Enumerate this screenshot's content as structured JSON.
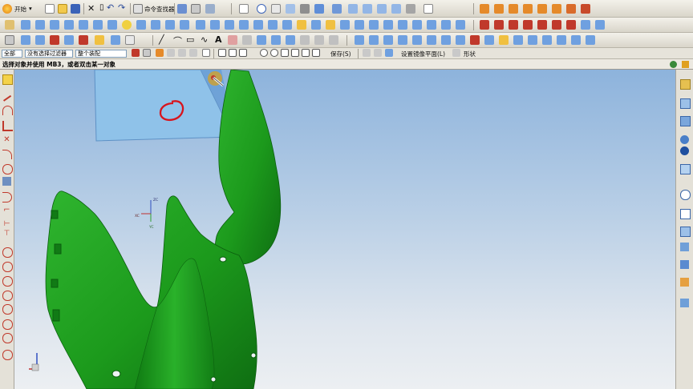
{
  "app": {
    "start_label": "开始",
    "command_finder_label": "命令查找器"
  },
  "filters": {
    "scope_value": "全部",
    "type_filter_value": "没有选择过滤器",
    "assembly_filter_value": "整个装配"
  },
  "toolbar4": {
    "save_label": "保存(S)",
    "mirror_plane_label": "设置镜像平面(L)",
    "shape_label": "形状"
  },
  "status": {
    "prompt": "选择对象并使用 MB3，或者双击某一对象"
  },
  "viewport": {
    "datum_plane_color": "#8fc3ea",
    "part_color": "#1f9a1f",
    "annotation_circle_color": "#d8141c",
    "background_top": "#8db3dc",
    "background_bottom": "#eceff2"
  },
  "triad": {
    "xc": "XC",
    "yc": "YC",
    "zc": "ZC"
  },
  "icons": {
    "left_toolbar": [
      "selection-icon",
      "line-icon",
      "arc-icon",
      "spline-icon",
      "point-icon",
      "fillet-icon",
      "offset-curve-icon",
      "trim-icon",
      "circle-icon",
      "sketch-icon",
      "constraint-icon",
      "dimension-icon",
      "curve-icon",
      "rotate-icon",
      "extend-icon",
      "intersect-icon",
      "project-icon",
      "curve-analysis-icon",
      "measure-icon",
      "circle-check-icon"
    ],
    "right_toolbar": [
      "assembly-navigator-icon",
      "constraint-navigator-icon",
      "part-navigator-icon",
      "reuse-library-icon",
      "history-icon",
      "system-materials-icon",
      "roles-icon",
      "clock-icon",
      "web-browser-icon",
      "palette-icon",
      "process-studio-icon",
      "manufacturing-wizard-icon",
      "specification-icon",
      "system-scenes-icon"
    ]
  }
}
